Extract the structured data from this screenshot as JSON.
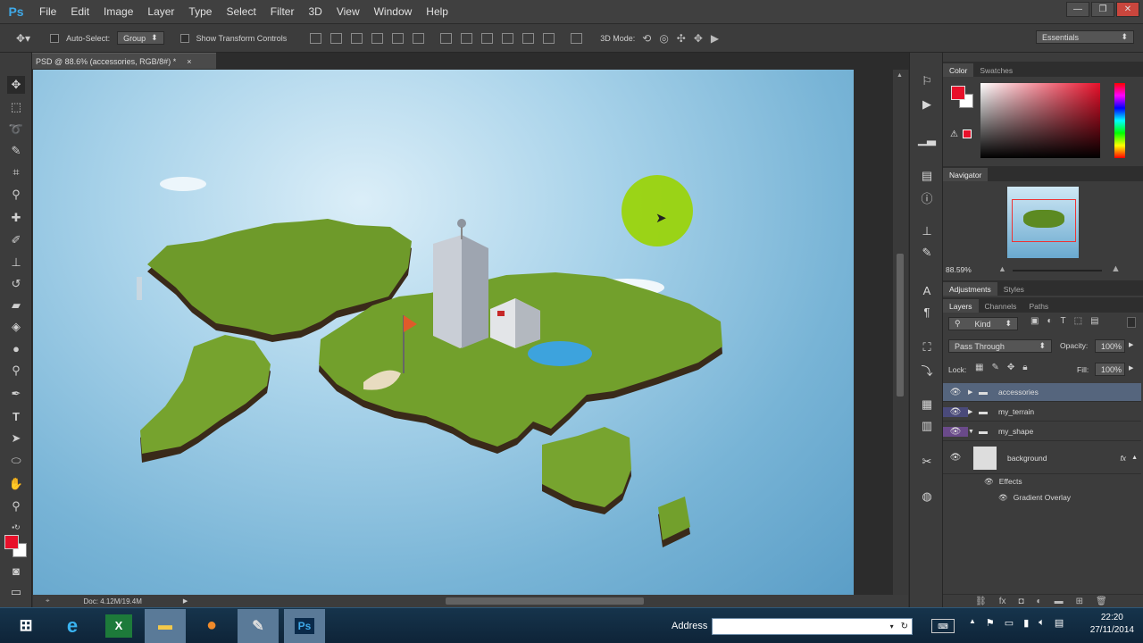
{
  "app": {
    "logo": "Ps",
    "name": "Adobe Photoshop"
  },
  "menu": [
    "File",
    "Edit",
    "Image",
    "Layer",
    "Type",
    "Select",
    "Filter",
    "3D",
    "View",
    "Window",
    "Help"
  ],
  "window_controls": {
    "minimize": "—",
    "restore": "❐",
    "close": "✕"
  },
  "options_bar": {
    "auto_select_label": "Auto-Select:",
    "auto_select_value": "Group",
    "show_transform_label": "Show Transform Controls",
    "mode_3d_label": "3D Mode:",
    "workspace": "Essentials"
  },
  "document": {
    "tab_title": "PSD @ 88.6% (accessories, RGB/8#) *",
    "tab_close": "×",
    "status": "Doc: 4.12M/19.4M"
  },
  "right_panels": {
    "color_tabs": [
      "Color",
      "Swatches"
    ],
    "navigator_tab": "Navigator",
    "navigator_zoom": "88.59%",
    "adjust_tabs": [
      "Adjustments",
      "Styles"
    ],
    "layers_tabs": [
      "Layers",
      "Channels",
      "Paths"
    ],
    "kind_label": "Kind",
    "blend_mode": "Pass Through",
    "opacity_label": "Opacity:",
    "opacity_value": "100%",
    "lock_label": "Lock:",
    "fill_label": "Fill:",
    "fill_value": "100%",
    "layers": [
      {
        "name": "accessories",
        "type": "group",
        "selected": true
      },
      {
        "name": "my_terrain",
        "type": "group"
      },
      {
        "name": "my_shape",
        "type": "group"
      },
      {
        "name": "background",
        "type": "layer",
        "fx": "fx"
      }
    ],
    "effects_label": "Effects",
    "effect_name": "Gradient Overlay"
  },
  "taskbar": {
    "address_label": "Address",
    "time": "22:20",
    "date": "27/11/2014",
    "apps": [
      "windows-start",
      "internet-explorer",
      "excel",
      "file-explorer",
      "firefox",
      "toolbox",
      "photoshop"
    ]
  },
  "colors": {
    "foreground": "#e8102a",
    "background": "#ffffff",
    "cursor_highlight": "#9ad400"
  }
}
